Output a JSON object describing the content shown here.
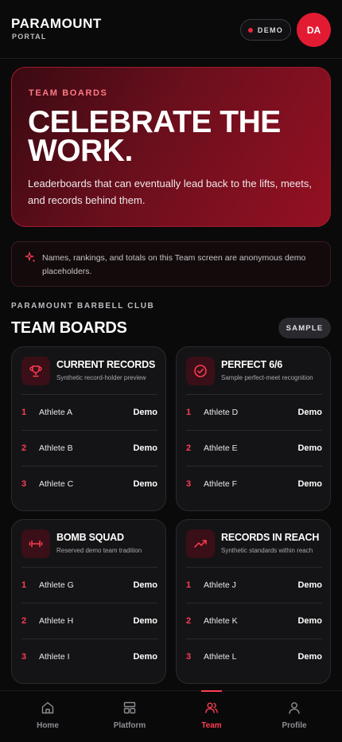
{
  "header": {
    "brand_title": "PARAMOUNT",
    "brand_subtitle": "PORTAL",
    "demo_badge": "DEMO",
    "avatar_initials": "DA"
  },
  "hero": {
    "kicker": "TEAM BOARDS",
    "title": "CELEBRATE THE WORK.",
    "description": "Leaderboards that can eventually lead back to the lifts, meets, and records behind them."
  },
  "notice": {
    "text": "Names, rankings, and totals on this Team screen are anonymous demo placeholders."
  },
  "section": {
    "club": "PARAMOUNT BARBELL CLUB",
    "title": "TEAM BOARDS",
    "badge": "SAMPLE"
  },
  "boards": [
    {
      "icon": "trophy-icon",
      "title": "CURRENT RECORDS",
      "subtitle": "Synthetic record-holder preview",
      "rows": [
        {
          "rank": "1",
          "athlete": "Athlete A",
          "value": "Demo"
        },
        {
          "rank": "2",
          "athlete": "Athlete B",
          "value": "Demo"
        },
        {
          "rank": "3",
          "athlete": "Athlete C",
          "value": "Demo"
        }
      ]
    },
    {
      "icon": "check-circle-icon",
      "title": "PERFECT 6/6",
      "subtitle": "Sample perfect-meet recognition",
      "rows": [
        {
          "rank": "1",
          "athlete": "Athlete D",
          "value": "Demo"
        },
        {
          "rank": "2",
          "athlete": "Athlete E",
          "value": "Demo"
        },
        {
          "rank": "3",
          "athlete": "Athlete F",
          "value": "Demo"
        }
      ]
    },
    {
      "icon": "dumbbell-icon",
      "title": "BOMB SQUAD",
      "subtitle": "Reserved demo team tradition",
      "rows": [
        {
          "rank": "1",
          "athlete": "Athlete G",
          "value": "Demo"
        },
        {
          "rank": "2",
          "athlete": "Athlete H",
          "value": "Demo"
        },
        {
          "rank": "3",
          "athlete": "Athlete I",
          "value": "Demo"
        }
      ]
    },
    {
      "icon": "trend-up-icon",
      "title": "RECORDS IN REACH",
      "subtitle": "Synthetic standards within reach",
      "rows": [
        {
          "rank": "1",
          "athlete": "Athlete J",
          "value": "Demo"
        },
        {
          "rank": "2",
          "athlete": "Athlete K",
          "value": "Demo"
        },
        {
          "rank": "3",
          "athlete": "Athlete L",
          "value": "Demo"
        }
      ]
    }
  ],
  "nav": {
    "items": [
      {
        "label": "Home",
        "icon": "home-icon"
      },
      {
        "label": "Platform",
        "icon": "layout-icon"
      },
      {
        "label": "Team",
        "icon": "team-icon"
      },
      {
        "label": "Profile",
        "icon": "user-icon"
      }
    ],
    "active": "Team"
  },
  "colors": {
    "accent": "#ff3d52",
    "brand_red": "#e31b32",
    "background": "#0a0a0b"
  }
}
